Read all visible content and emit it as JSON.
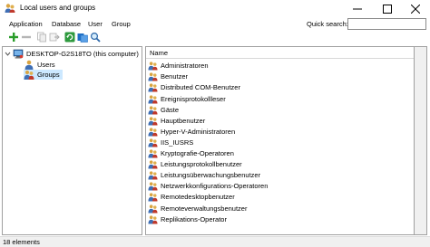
{
  "window": {
    "title": "Local users and groups",
    "icon": "users-groups-icon",
    "controls": [
      "minimize-icon",
      "maximize-icon",
      "close-icon"
    ]
  },
  "menu": {
    "items": [
      "Application",
      "Database",
      "User",
      "Group"
    ],
    "quick_search_label": "Quick search:",
    "quick_search_value": ""
  },
  "toolbar": {
    "icons": [
      "add-icon",
      "remove-icon",
      "copy-icon",
      "export-icon",
      "refresh-icon",
      "properties-icon",
      "search-icon"
    ]
  },
  "tree": {
    "computer": "DESKTOP-G2S18TO (this computer)",
    "children": [
      "Users",
      "Groups"
    ],
    "selected": "Groups"
  },
  "list": {
    "column": "Name",
    "items": [
      "Administratoren",
      "Benutzer",
      "Distributed COM-Benutzer",
      "Ereignisprotokollleser",
      "Gäste",
      "Hauptbenutzer",
      "Hyper-V-Administratoren",
      "IIS_IUSRS",
      "Kryptografie-Operatoren",
      "Leistungsprotokollbenutzer",
      "Leistungsüberwachungsbenutzer",
      "Netzwerkkonfigurations-Operatoren",
      "Remotedesktopbenutzer",
      "Remoteverwaltungsbenutzer",
      "Replikations-Operator"
    ]
  },
  "status": {
    "text": "18 elements"
  },
  "colors": {
    "selection": "#cce8ff",
    "add_green": "#2a9d2a",
    "pane_border": "#a0a0a0"
  }
}
